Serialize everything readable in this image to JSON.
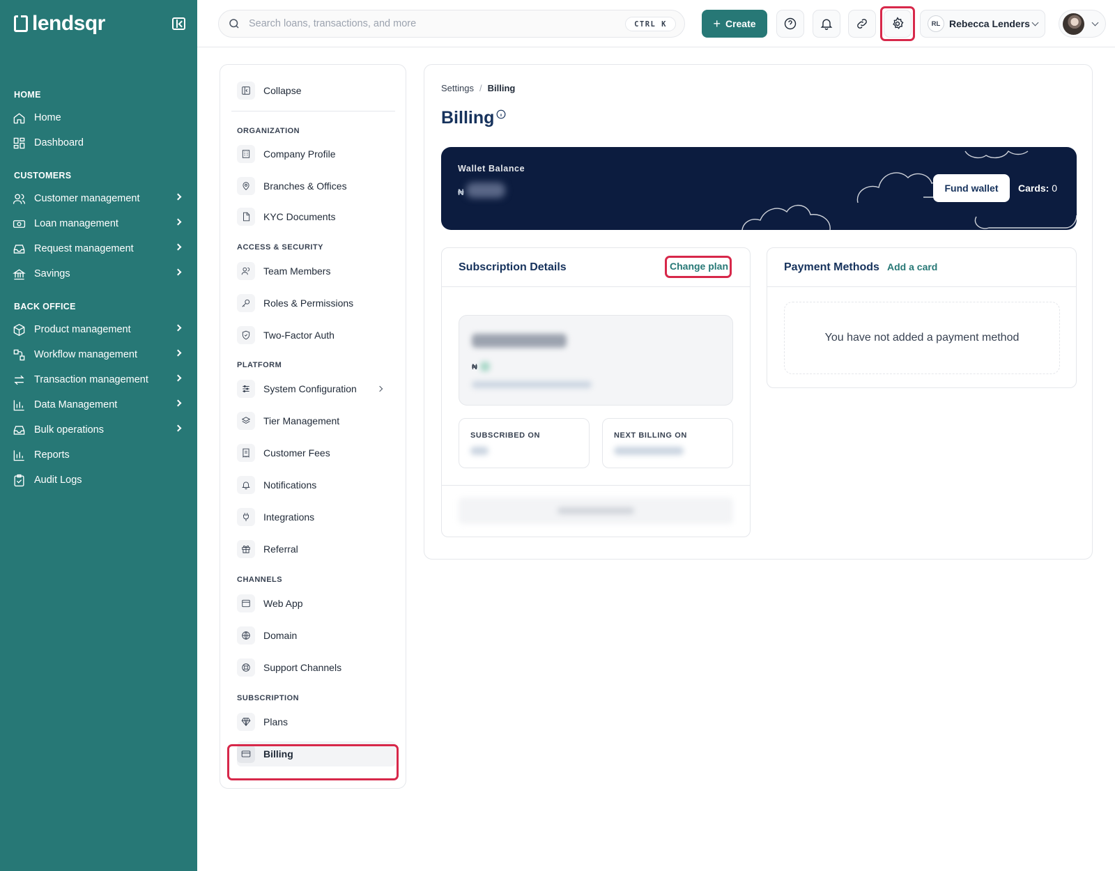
{
  "brand": {
    "name": "lendsqr"
  },
  "sidebar": {
    "sections": [
      {
        "label": "HOME"
      },
      {
        "label": "CUSTOMERS"
      },
      {
        "label": "BACK OFFICE"
      }
    ],
    "items": [
      {
        "label": "Home",
        "icon": "home-icon"
      },
      {
        "label": "Dashboard",
        "icon": "dashboard-icon"
      },
      {
        "label": "Customer management",
        "icon": "users-icon"
      },
      {
        "label": "Loan management",
        "icon": "money-icon"
      },
      {
        "label": "Request management",
        "icon": "inbox-icon"
      },
      {
        "label": "Savings",
        "icon": "savings-icon"
      },
      {
        "label": "Product management",
        "icon": "box-icon"
      },
      {
        "label": "Workflow management",
        "icon": "workflow-icon"
      },
      {
        "label": "Transaction management",
        "icon": "transfer-icon"
      },
      {
        "label": "Data Management",
        "icon": "chart-icon"
      },
      {
        "label": "Bulk operations",
        "icon": "tray-icon"
      },
      {
        "label": "Reports",
        "icon": "reports-icon"
      },
      {
        "label": "Audit Logs",
        "icon": "clipboard-icon"
      }
    ]
  },
  "header": {
    "search_placeholder": "Search loans, transactions, and more",
    "shortcut": "CTRL K",
    "create_label": "Create",
    "account": {
      "initials": "RL",
      "name": "Rebecca Lenders"
    }
  },
  "settings_nav": {
    "collapse_label": "Collapse",
    "groups": [
      {
        "heading": "ORGANIZATION",
        "items": [
          "Company Profile",
          "Branches & Offices",
          "KYC Documents"
        ]
      },
      {
        "heading": "ACCESS & SECURITY",
        "items": [
          "Team Members",
          "Roles & Permissions",
          "Two-Factor Auth"
        ]
      },
      {
        "heading": "PLATFORM",
        "items": [
          "System Configuration",
          "Tier Management",
          "Customer Fees",
          "Notifications",
          "Integrations",
          "Referral"
        ]
      },
      {
        "heading": "CHANNELS",
        "items": [
          "Web App",
          "Domain",
          "Support Channels"
        ]
      },
      {
        "heading": "SUBSCRIPTION",
        "items": [
          "Plans",
          "Billing"
        ]
      }
    ],
    "active": "Billing"
  },
  "billing": {
    "breadcrumb": {
      "parent": "Settings",
      "separator": "/",
      "current": "Billing"
    },
    "title": "Billing",
    "wallet": {
      "label": "Wallet Balance",
      "currency": "₦",
      "fund_button": "Fund wallet",
      "cards_label": "Cards:",
      "cards_count": "0"
    },
    "subscription": {
      "title": "Subscription Details",
      "change_plan": "Change plan",
      "currency": "₦",
      "subscribed_on_label": "SUBSCRIBED ON",
      "next_billing_label": "NEXT BILLING ON"
    },
    "payment_methods": {
      "title": "Payment Methods",
      "add_card": "Add a card",
      "empty_text": "You have not added a payment method"
    }
  },
  "colors": {
    "brand": "#277876",
    "navy": "#0c1c3f",
    "highlight": "#d7284a"
  }
}
